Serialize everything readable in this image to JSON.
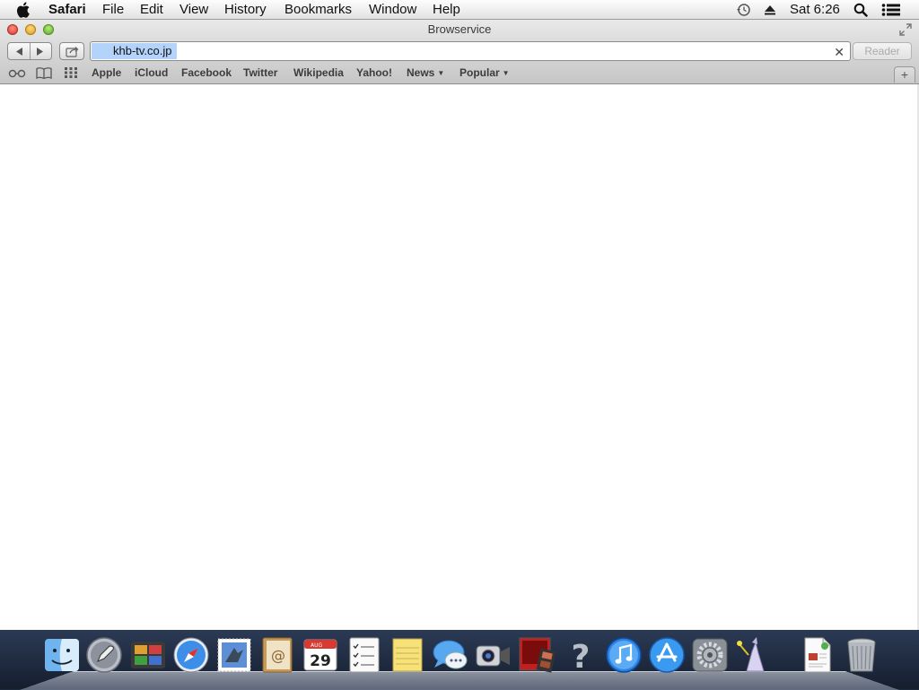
{
  "menubar": {
    "app_name": "Safari",
    "menus": [
      "File",
      "Edit",
      "View",
      "History",
      "Bookmarks",
      "Window",
      "Help"
    ],
    "clock": "Sat 6:26"
  },
  "window": {
    "title": "Browservice",
    "address": "khb-tv.co.jp",
    "reader_label": "Reader",
    "new_tab_label": "+"
  },
  "bookmarks": {
    "items": [
      "Apple",
      "iCloud",
      "Facebook",
      "Twitter",
      "Wikipedia",
      "Yahoo!",
      "News",
      "Popular"
    ]
  },
  "dock": {
    "calendar_month": "AUG",
    "calendar_day": "29",
    "apps": [
      "finder",
      "launchpad",
      "photo-booth",
      "safari",
      "mail",
      "contacts",
      "calendar",
      "reminders",
      "notes",
      "messages",
      "facetime",
      "photo-booth-strip",
      "help",
      "itunes",
      "app-store",
      "system-preferences",
      "wizard",
      "document",
      "trash"
    ]
  }
}
